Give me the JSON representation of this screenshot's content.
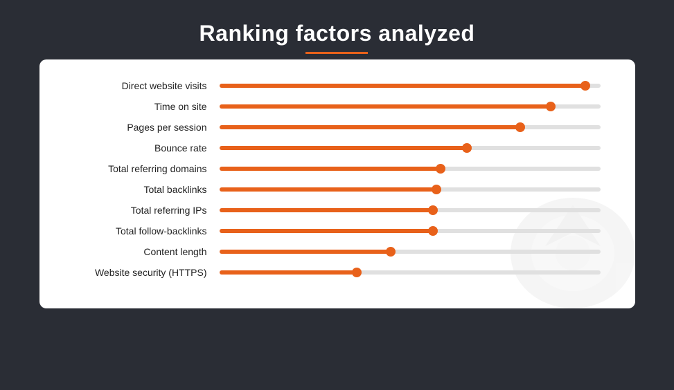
{
  "header": {
    "title": "Ranking factors analyzed",
    "accent_color": "#e8611a"
  },
  "chart": {
    "rows": [
      {
        "label": "Direct website visits",
        "pct": 96
      },
      {
        "label": "Time on site",
        "pct": 87
      },
      {
        "label": "Pages per session",
        "pct": 79
      },
      {
        "label": "Bounce rate",
        "pct": 65
      },
      {
        "label": "Total referring domains",
        "pct": 58
      },
      {
        "label": "Total backlinks",
        "pct": 57
      },
      {
        "label": "Total referring IPs",
        "pct": 56
      },
      {
        "label": "Total follow-backlinks",
        "pct": 56
      },
      {
        "label": "Content length",
        "pct": 45
      },
      {
        "label": "Website security (HTTPS)",
        "pct": 36
      }
    ]
  }
}
